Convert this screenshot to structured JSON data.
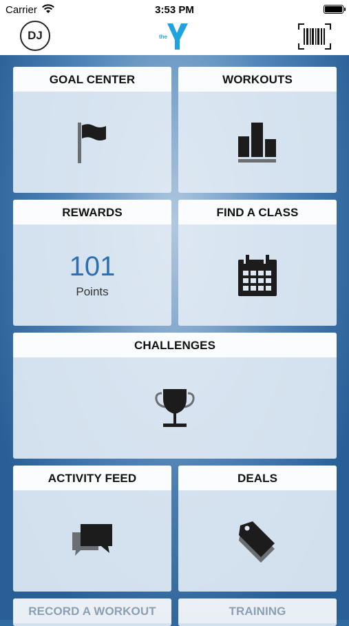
{
  "status_bar": {
    "carrier": "Carrier",
    "time": "3:53 PM"
  },
  "nav": {
    "avatar_initials": "DJ",
    "logo_text": "the"
  },
  "tiles": {
    "goal_center": "GOAL CENTER",
    "workouts": "WORKOUTS",
    "rewards": "REWARDS",
    "rewards_points": "101",
    "rewards_points_label": "Points",
    "find_a_class": "FIND A CLASS",
    "challenges": "CHALLENGES",
    "activity_feed": "ACTIVITY FEED",
    "deals": "DEALS",
    "record_a_workout": "RECORD A WORKOUT",
    "training": "TRAINING"
  },
  "colors": {
    "accent": "#2d6fb0",
    "logo": "#1fa3df",
    "background": "#2f6aa0"
  },
  "icons": [
    "wifi-icon",
    "battery-icon",
    "ymca-logo",
    "barcode-icon",
    "flag-icon",
    "bar-chart-icon",
    "calendar-icon",
    "trophy-icon",
    "chat-icon",
    "tag-icon"
  ]
}
